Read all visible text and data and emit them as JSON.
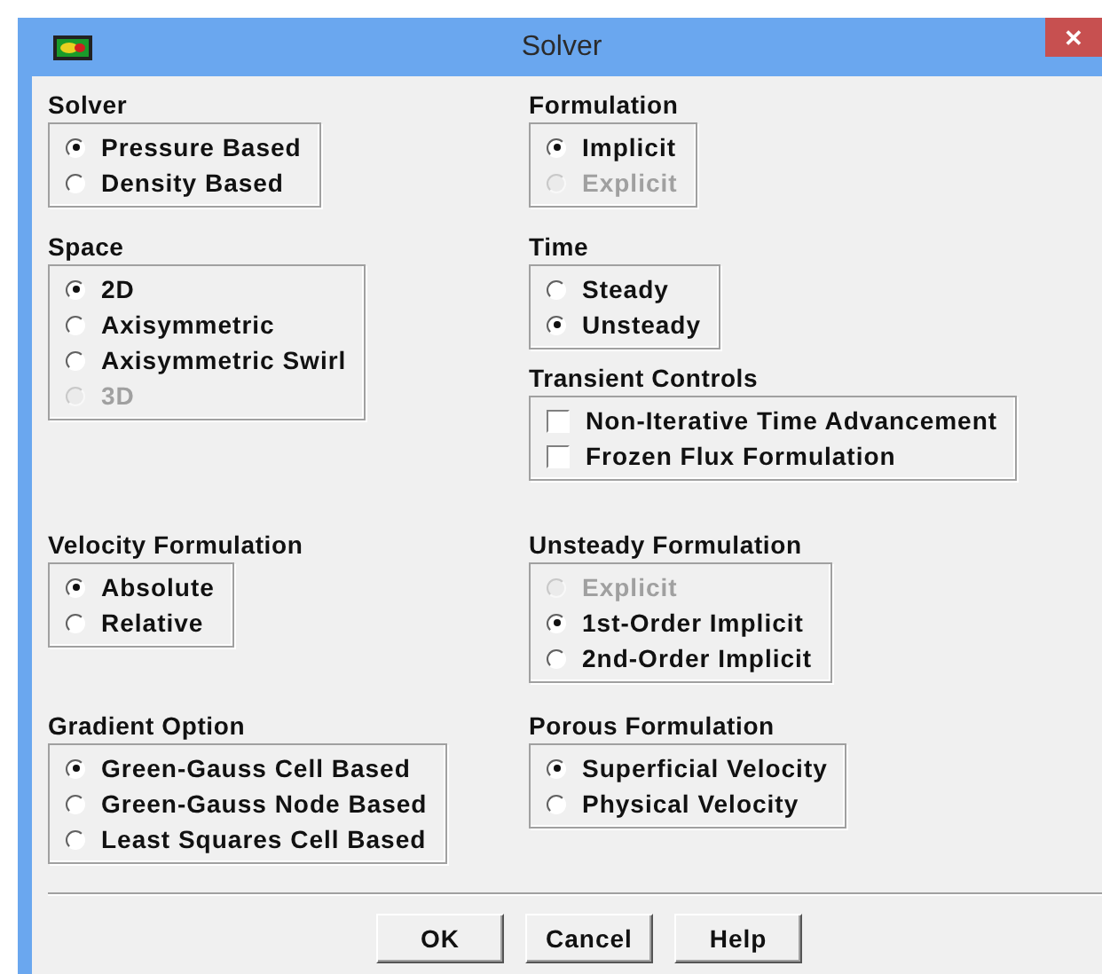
{
  "window": {
    "title": "Solver",
    "close": "✕"
  },
  "rows": [
    {
      "cells": [
        [
          {
            "title": "Solver",
            "options": [
              {
                "kind": "radio",
                "label": "Pressure Based",
                "selected": true,
                "disabled": false
              },
              {
                "kind": "radio",
                "label": "Density Based",
                "selected": false,
                "disabled": false
              }
            ]
          }
        ],
        [
          {
            "title": "Formulation",
            "options": [
              {
                "kind": "radio",
                "label": "Implicit",
                "selected": true,
                "disabled": false
              },
              {
                "kind": "radio",
                "label": "Explicit",
                "selected": false,
                "disabled": true
              }
            ]
          }
        ]
      ]
    },
    {
      "cells": [
        [
          {
            "title": "Space",
            "options": [
              {
                "kind": "radio",
                "label": "2D",
                "selected": true,
                "disabled": false
              },
              {
                "kind": "radio",
                "label": "Axisymmetric",
                "selected": false,
                "disabled": false
              },
              {
                "kind": "radio",
                "label": "Axisymmetric Swirl",
                "selected": false,
                "disabled": false
              },
              {
                "kind": "radio",
                "label": "3D",
                "selected": false,
                "disabled": true
              }
            ]
          }
        ],
        [
          {
            "title": "Time",
            "options": [
              {
                "kind": "radio",
                "label": "Steady",
                "selected": false,
                "disabled": false
              },
              {
                "kind": "radio",
                "label": "Unsteady",
                "selected": true,
                "disabled": false
              }
            ]
          },
          {
            "title": "Transient Controls",
            "options": [
              {
                "kind": "checkbox",
                "label": "Non-Iterative Time Advancement",
                "checked": false,
                "disabled": false
              },
              {
                "kind": "checkbox",
                "label": "Frozen Flux Formulation",
                "checked": false,
                "disabled": false
              }
            ]
          }
        ]
      ]
    },
    {
      "cells": [
        [
          {
            "title": "Velocity Formulation",
            "options": [
              {
                "kind": "radio",
                "label": "Absolute",
                "selected": true,
                "disabled": false
              },
              {
                "kind": "radio",
                "label": "Relative",
                "selected": false,
                "disabled": false
              }
            ]
          }
        ],
        [
          {
            "title": "Unsteady Formulation",
            "options": [
              {
                "kind": "radio",
                "label": "Explicit",
                "selected": false,
                "disabled": true
              },
              {
                "kind": "radio",
                "label": "1st-Order Implicit",
                "selected": true,
                "disabled": false
              },
              {
                "kind": "radio",
                "label": "2nd-Order Implicit",
                "selected": false,
                "disabled": false
              }
            ]
          }
        ]
      ]
    },
    {
      "cells": [
        [
          {
            "title": "Gradient Option",
            "options": [
              {
                "kind": "radio",
                "label": "Green-Gauss Cell Based",
                "selected": true,
                "disabled": false
              },
              {
                "kind": "radio",
                "label": "Green-Gauss Node Based",
                "selected": false,
                "disabled": false
              },
              {
                "kind": "radio",
                "label": "Least Squares Cell Based",
                "selected": false,
                "disabled": false
              }
            ]
          }
        ],
        [
          {
            "title": "Porous Formulation",
            "options": [
              {
                "kind": "radio",
                "label": "Superficial Velocity",
                "selected": true,
                "disabled": false
              },
              {
                "kind": "radio",
                "label": "Physical Velocity",
                "selected": false,
                "disabled": false
              }
            ]
          }
        ]
      ]
    }
  ],
  "buttons": [
    "OK",
    "Cancel",
    "Help"
  ]
}
